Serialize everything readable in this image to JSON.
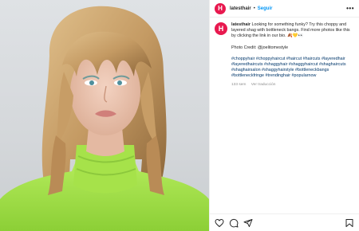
{
  "account": {
    "avatar_letter": "H",
    "username": "latesthair",
    "dot": "•",
    "follow_label": "Seguir",
    "more_label": "•••",
    "brand_color": "#e8194f"
  },
  "caption": {
    "username": "latesthair",
    "text": "Looking for something funky? Try this choppy and layered shag with bottleneck bangs. Find more photos like this by clicking the link in our bio. 🍂💛👀",
    "credit": "Photo Credit: @joelitomestyle",
    "hashtags": "#choppyhair #choppyhaircut #haircut #haircuts #layeredhair #layeredhaircuts #shaggyhair #shaggyhaircut #shaghaircuts #shaghairsalon #shaggyhairstyle #bottleneckbangs #bottleneckfringe #trendinghair #popularnow",
    "age": "133 sem",
    "translation": "Ver traducción"
  },
  "actions": {
    "like_icon": "heart-icon",
    "comment_icon": "comment-icon",
    "share_icon": "share-icon",
    "save_icon": "bookmark-icon"
  },
  "photo": {
    "subject": "Woman with a choppy layered shag haircut and bottleneck bangs wearing a lime green turtleneck",
    "sweater_color": "#a6e24a",
    "hair_color": "#c49a63"
  }
}
